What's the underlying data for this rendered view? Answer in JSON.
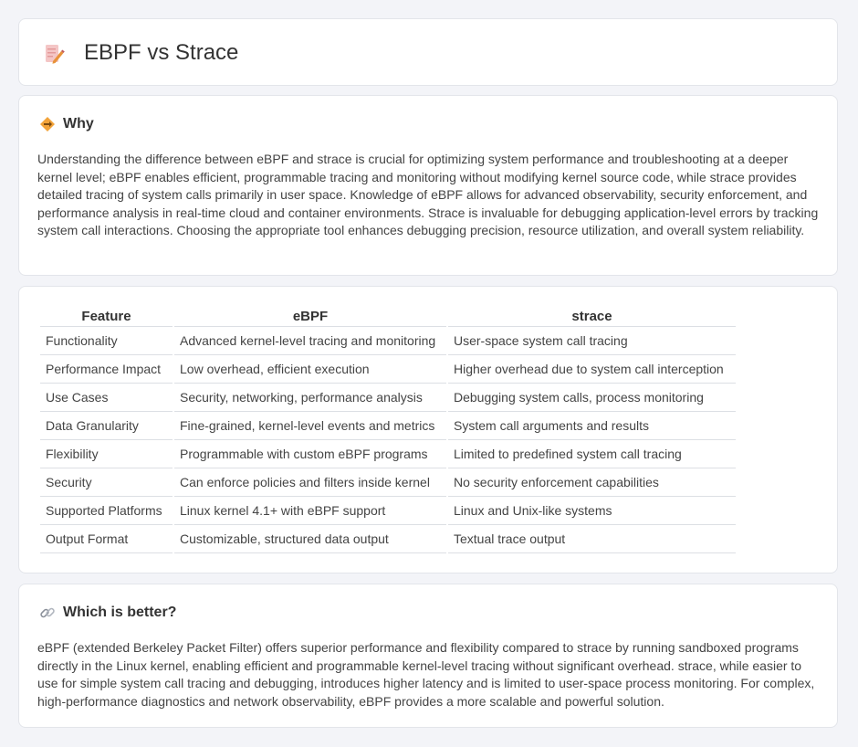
{
  "header": {
    "title": "EBPF vs Strace",
    "icon": "document-pencil-icon"
  },
  "why": {
    "heading": "Why",
    "icon": "diamond-sign-icon",
    "text": "Understanding the difference between eBPF and strace is crucial for optimizing system performance and troubleshooting at a deeper kernel level; eBPF enables efficient, programmable tracing and monitoring without modifying kernel source code, while strace provides detailed tracing of system calls primarily in user space. Knowledge of eBPF allows for advanced observability, security enforcement, and performance analysis in real-time cloud and container environments. Strace is invaluable for debugging application-level errors by tracking system call interactions. Choosing the appropriate tool enhances debugging precision, resource utilization, and overall system reliability."
  },
  "table": {
    "headers": [
      "Feature",
      "eBPF",
      "strace"
    ],
    "rows": [
      [
        "Functionality",
        "Advanced kernel-level tracing and monitoring",
        "User-space system call tracing"
      ],
      [
        "Performance Impact",
        "Low overhead, efficient execution",
        "Higher overhead due to system call interception"
      ],
      [
        "Use Cases",
        "Security, networking, performance analysis",
        "Debugging system calls, process monitoring"
      ],
      [
        "Data Granularity",
        "Fine-grained, kernel-level events and metrics",
        "System call arguments and results"
      ],
      [
        "Flexibility",
        "Programmable with custom eBPF programs",
        "Limited to predefined system call tracing"
      ],
      [
        "Security",
        "Can enforce policies and filters inside kernel",
        "No security enforcement capabilities"
      ],
      [
        "Supported Platforms",
        "Linux kernel 4.1+ with eBPF support",
        "Linux and Unix-like systems"
      ],
      [
        "Output Format",
        "Customizable, structured data output",
        "Textual trace output"
      ]
    ]
  },
  "better": {
    "heading": "Which is better?",
    "icon": "link-icon",
    "text": "eBPF (extended Berkeley Packet Filter) offers superior performance and flexibility compared to strace by running sandboxed programs directly in the Linux kernel, enabling efficient and programmable kernel-level tracing without significant overhead. strace, while easier to use for simple system call tracing and debugging, introduces higher latency and is limited to user-space process monitoring. For complex, high-performance diagnostics and network observability, eBPF provides a more scalable and powerful solution."
  },
  "colors": {
    "background": "#f3f4f8",
    "card": "#ffffff",
    "accent": "#e8923a"
  }
}
